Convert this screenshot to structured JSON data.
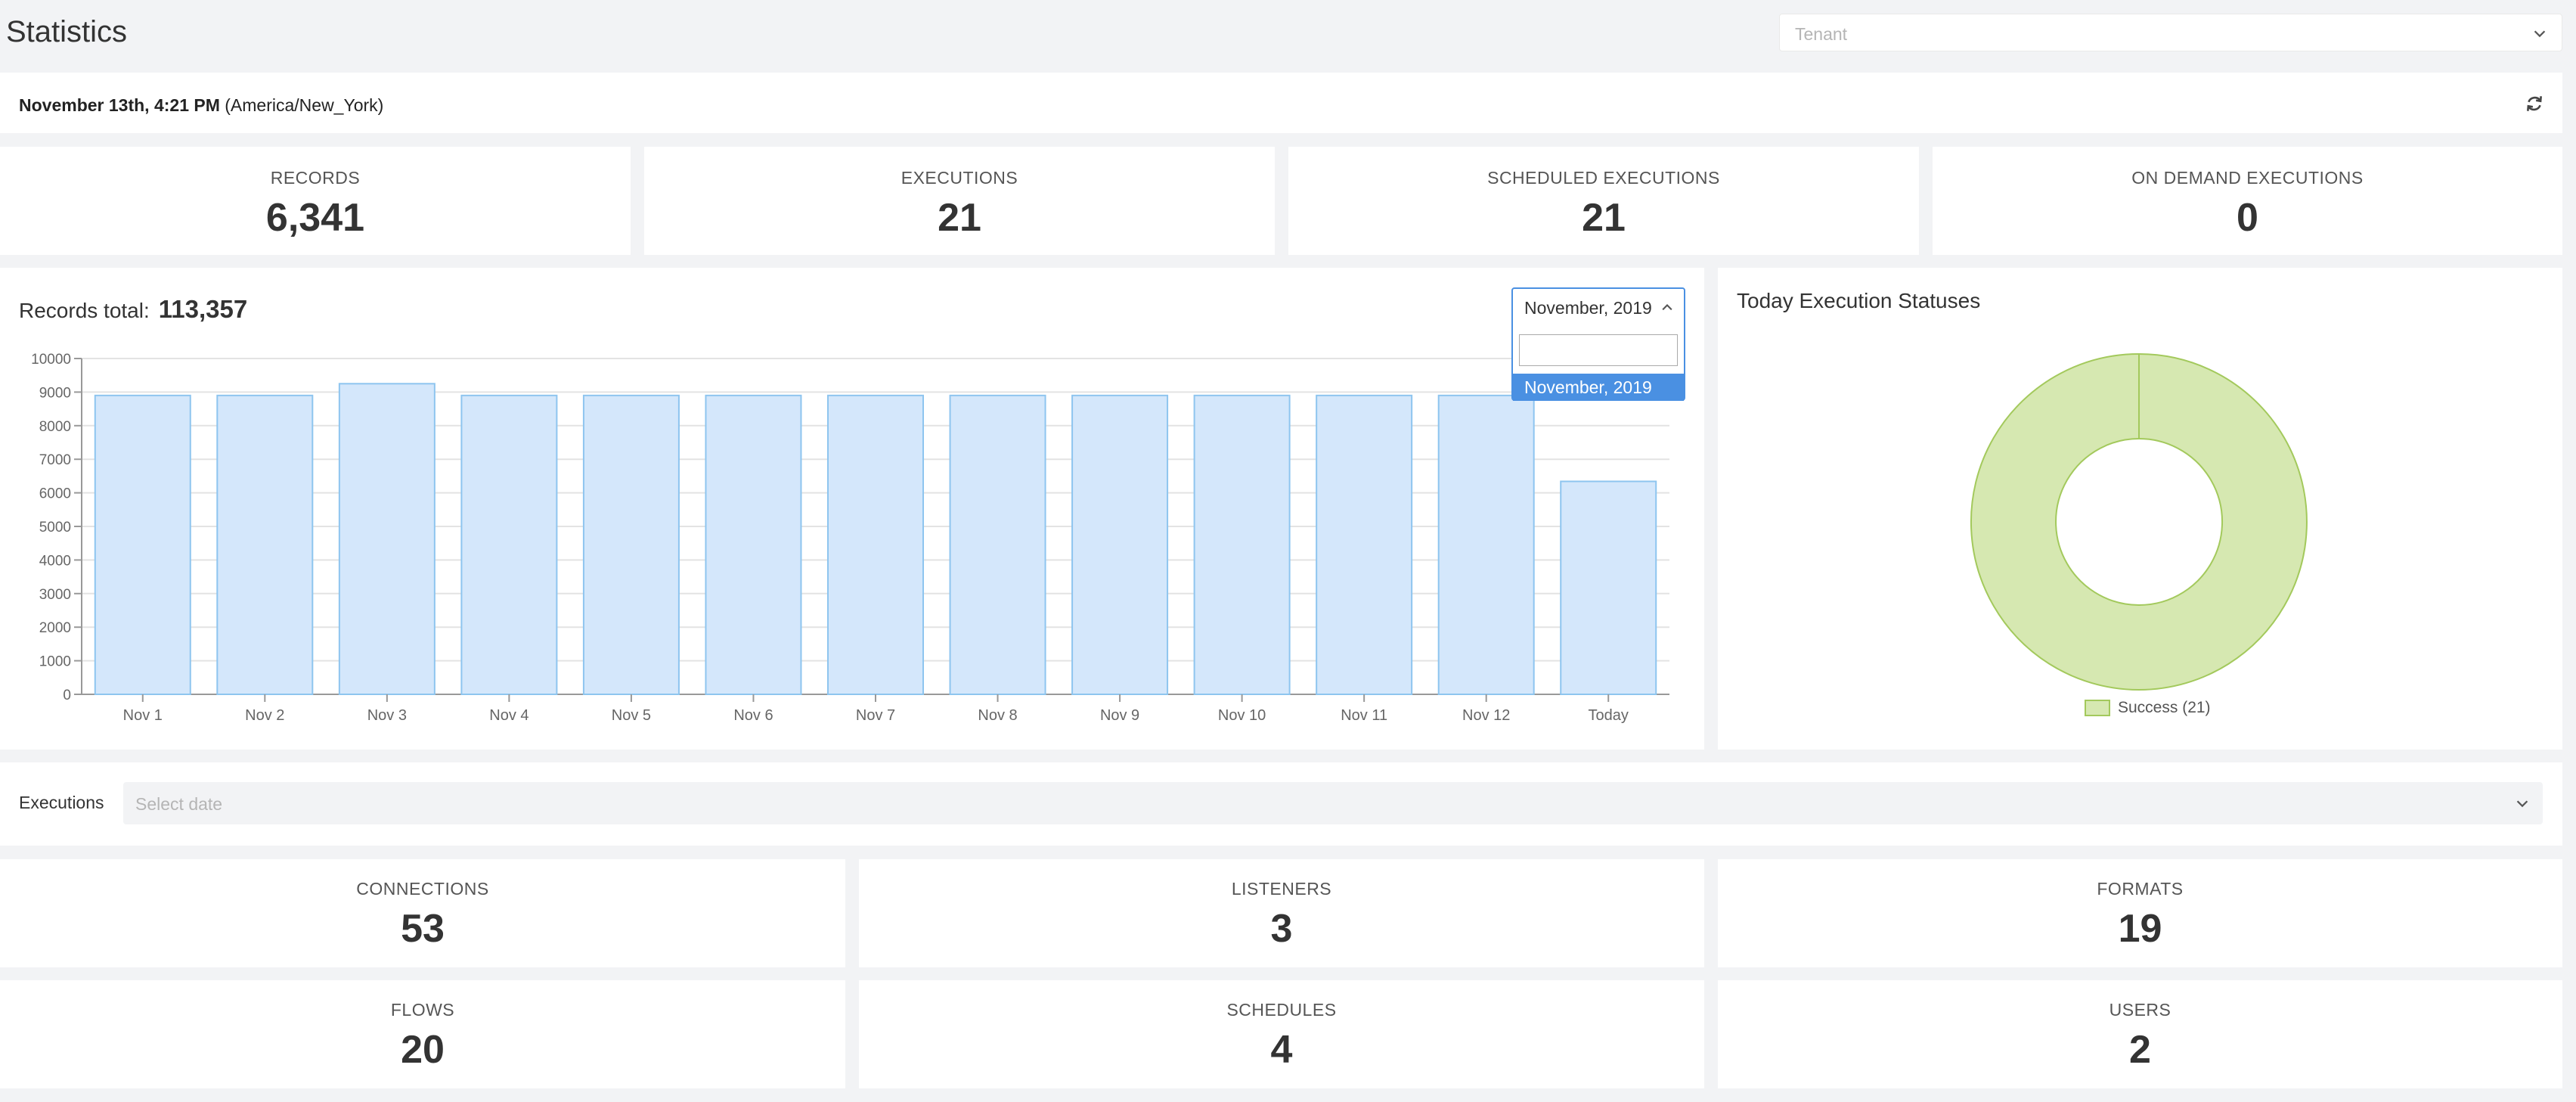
{
  "page": {
    "title": "Statistics"
  },
  "tenant": {
    "placeholder": "Tenant"
  },
  "datebar": {
    "date": "November 13th, 4:21 PM",
    "timezone": "(America/New_York)"
  },
  "top_stats": [
    {
      "label": "RECORDS",
      "value": "6,341"
    },
    {
      "label": "EXECUTIONS",
      "value": "21"
    },
    {
      "label": "SCHEDULED EXECUTIONS",
      "value": "21"
    },
    {
      "label": "ON DEMAND EXECUTIONS",
      "value": "0"
    }
  ],
  "records": {
    "label": "Records total:",
    "total": "113,357",
    "month_select": {
      "selected": "November, 2019",
      "search_value": "",
      "options": [
        "November, 2019"
      ]
    }
  },
  "pie": {
    "title": "Today Execution Statuses",
    "legend": "Success (21)",
    "fill": "#d6e8b1",
    "stroke": "#a3c95c"
  },
  "executions": {
    "label": "Executions",
    "placeholder": "Select date"
  },
  "bottom_stats": [
    {
      "label": "CONNECTIONS",
      "value": "53"
    },
    {
      "label": "LISTENERS",
      "value": "3"
    },
    {
      "label": "FORMATS",
      "value": "19"
    },
    {
      "label": "FLOWS",
      "value": "20"
    },
    {
      "label": "SCHEDULES",
      "value": "4"
    },
    {
      "label": "USERS",
      "value": "2"
    }
  ],
  "colors": {
    "bar_fill": "#d4e7fb",
    "bar_stroke": "#8ec5ef",
    "accent": "#4a90e2"
  },
  "chart_data": {
    "type": "bar",
    "categories": [
      "Nov 1",
      "Nov 2",
      "Nov 3",
      "Nov 4",
      "Nov 5",
      "Nov 6",
      "Nov 7",
      "Nov 8",
      "Nov 9",
      "Nov 10",
      "Nov 11",
      "Nov 12",
      "Today"
    ],
    "values": [
      8900,
      8900,
      9250,
      8900,
      8900,
      8900,
      8900,
      8900,
      8900,
      8900,
      8900,
      8900,
      6341
    ],
    "yticks": [
      0,
      1000,
      2000,
      3000,
      4000,
      5000,
      6000,
      7000,
      8000,
      9000,
      10000
    ],
    "ylim": [
      0,
      10000
    ],
    "grid": true
  }
}
